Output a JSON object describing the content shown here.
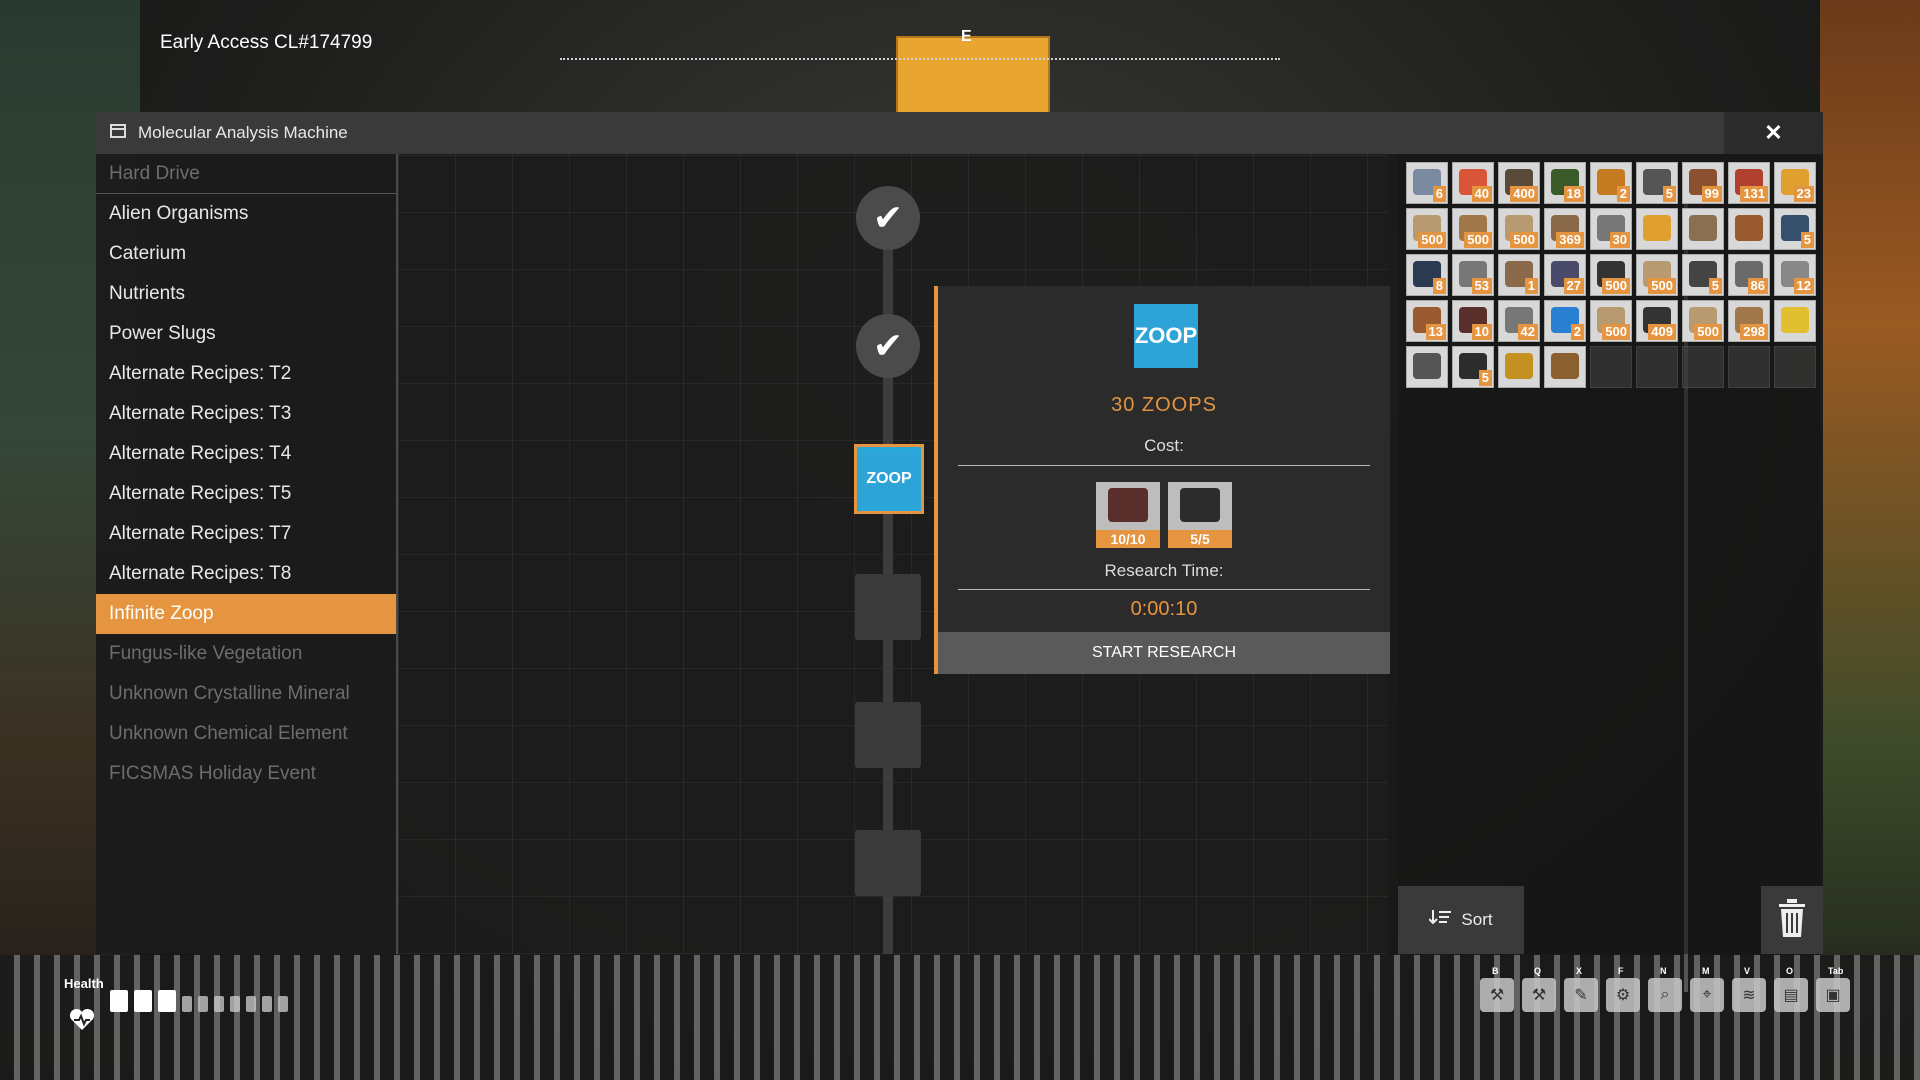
{
  "hud": {
    "build_label": "Early Access CL#174799",
    "compass_letter": "E",
    "health_label": "Health",
    "health_bars_full": 3,
    "health_bars_total": 10
  },
  "window": {
    "title": "Molecular Analysis Machine",
    "close_label": "✕"
  },
  "categories": [
    {
      "label": "Hard Drive",
      "state": "disabled"
    },
    {
      "label": "Alien Organisms",
      "state": "normal"
    },
    {
      "label": "Caterium",
      "state": "normal"
    },
    {
      "label": "Nutrients",
      "state": "normal"
    },
    {
      "label": "Power Slugs",
      "state": "normal"
    },
    {
      "label": "Alternate Recipes: T2",
      "state": "normal"
    },
    {
      "label": "Alternate Recipes: T3",
      "state": "normal"
    },
    {
      "label": "Alternate Recipes: T4",
      "state": "normal"
    },
    {
      "label": "Alternate Recipes: T5",
      "state": "normal"
    },
    {
      "label": "Alternate Recipes: T7",
      "state": "normal"
    },
    {
      "label": "Alternate Recipes: T8",
      "state": "normal"
    },
    {
      "label": "Infinite Zoop",
      "state": "selected"
    },
    {
      "label": "Fungus-like Vegetation",
      "state": "disabled"
    },
    {
      "label": "Unknown Crystalline Mineral",
      "state": "disabled"
    },
    {
      "label": "Unknown Chemical Element",
      "state": "disabled"
    },
    {
      "label": "FICSMAS Holiday Event",
      "state": "disabled"
    }
  ],
  "tree": {
    "completed_mark": "✔",
    "current_logo": "ZOOP"
  },
  "detail": {
    "logo_text": "ZOOP",
    "title": "30 ZOOPS",
    "cost_label": "Cost:",
    "costs": [
      {
        "count": "10/10",
        "icon": "pipe-icon",
        "color": "#5a2e2a"
      },
      {
        "count": "5/5",
        "icon": "plate-icon",
        "color": "#2c2c2c"
      }
    ],
    "time_label": "Research Time:",
    "time_value": "0:00:10",
    "start_label": "START RESEARCH"
  },
  "inventory": {
    "slots": [
      {
        "qty": "6",
        "color": "#7a8aa0"
      },
      {
        "qty": "40",
        "color": "#d9553a"
      },
      {
        "qty": "400",
        "color": "#5a4a3a"
      },
      {
        "qty": "18",
        "color": "#3a5a2a"
      },
      {
        "qty": "2",
        "color": "#c47a20"
      },
      {
        "qty": "5",
        "color": "#555"
      },
      {
        "qty": "99",
        "color": "#8a5030"
      },
      {
        "qty": "131",
        "color": "#b24030"
      },
      {
        "qty": "23",
        "color": "#e0a030"
      },
      {
        "qty": "500",
        "color": "#b89a70"
      },
      {
        "qty": "500",
        "color": "#a0784a"
      },
      {
        "qty": "500",
        "color": "#b89a70"
      },
      {
        "qty": "369",
        "color": "#8a6a4a"
      },
      {
        "qty": "30",
        "color": "#777"
      },
      {
        "qty": "",
        "color": "#e0a030"
      },
      {
        "qty": "",
        "color": "#8a7050"
      },
      {
        "qty": "",
        "color": "#9a5a30"
      },
      {
        "qty": "5",
        "color": "#34506a"
      },
      {
        "qty": "8",
        "color": "#2a3a50"
      },
      {
        "qty": "53",
        "color": "#777"
      },
      {
        "qty": "1",
        "color": "#8a6a4a"
      },
      {
        "qty": "27",
        "color": "#4a4a6a"
      },
      {
        "qty": "500",
        "color": "#333"
      },
      {
        "qty": "500",
        "color": "#b89a70"
      },
      {
        "qty": "5",
        "color": "#444"
      },
      {
        "qty": "86",
        "color": "#6a6a6a"
      },
      {
        "qty": "12",
        "color": "#888"
      },
      {
        "qty": "13",
        "color": "#9a5a30"
      },
      {
        "qty": "10",
        "color": "#5a2e2a"
      },
      {
        "qty": "42",
        "color": "#777"
      },
      {
        "qty": "2",
        "color": "#2a80d0"
      },
      {
        "qty": "500",
        "color": "#b89a70"
      },
      {
        "qty": "409",
        "color": "#333"
      },
      {
        "qty": "500",
        "color": "#b89a70"
      },
      {
        "qty": "298",
        "color": "#a0784a"
      },
      {
        "qty": "",
        "color": "#e0c030"
      },
      {
        "qty": "",
        "color": "#555"
      },
      {
        "qty": "5",
        "color": "#2c2c2c"
      },
      {
        "qty": "",
        "color": "#c49020"
      },
      {
        "qty": "",
        "color": "#8a6030"
      }
    ],
    "total_slots": 45,
    "sort_label": "Sort"
  },
  "toolbar": [
    {
      "key": "B",
      "icon": "build-gun-icon"
    },
    {
      "key": "Q",
      "icon": "hammer-icon"
    },
    {
      "key": "X",
      "icon": "brush-icon"
    },
    {
      "key": "F",
      "icon": "dismantle-icon"
    },
    {
      "key": "N",
      "icon": "scanner-icon"
    },
    {
      "key": "M",
      "icon": "map-icon"
    },
    {
      "key": "V",
      "icon": "wifi-icon"
    },
    {
      "key": "O",
      "icon": "codex-icon"
    },
    {
      "key": "Tab",
      "icon": "inventory-icon"
    }
  ]
}
